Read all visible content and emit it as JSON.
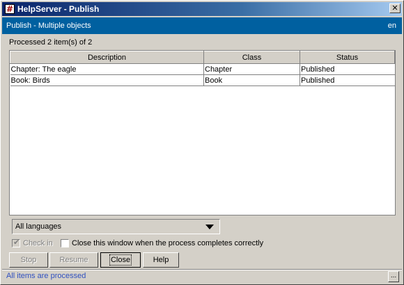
{
  "window": {
    "title": "HelpServer - Publish",
    "app_icon_glyph": "#",
    "close_glyph": "✕"
  },
  "header": {
    "title": "Publish - Multiple objects",
    "language": "en"
  },
  "progress_text": "Processed 2 item(s) of 2",
  "table": {
    "columns": [
      "Description",
      "Class",
      "Status"
    ],
    "rows": [
      [
        "Chapter: The eagle",
        "Chapter",
        "Published"
      ],
      [
        "Book: Birds",
        "Book",
        "Published"
      ]
    ]
  },
  "language_select": {
    "selected": "All languages"
  },
  "options": {
    "check_in_label": "Check in",
    "check_in_checked": true,
    "close_when_done_label": "Close this window when the process completes correctly",
    "close_when_done_checked": false
  },
  "buttons": {
    "stop": "Stop",
    "resume": "Resume",
    "close": "Close",
    "help": "Help"
  },
  "statusbar": {
    "text": "All items are processed",
    "more_glyph": "..."
  },
  "colors": {
    "title_gradient_start": "#0a246a",
    "header_bg": "#0060a0",
    "face": "#d4d0c8",
    "status_text": "#3050c0"
  }
}
